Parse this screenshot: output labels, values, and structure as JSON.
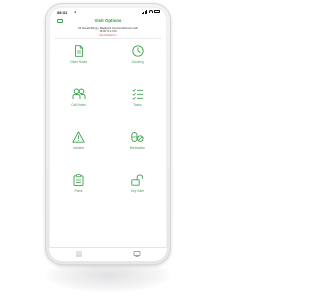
{
  "status_bar": {
    "time": "08:31",
    "nav_indicator": "◂"
  },
  "header": {
    "title": "Visit Options",
    "back_icon": "back-arrow-icon"
  },
  "visit_info": {
    "line1": "Mr Ronald Burgy | Blackpool Council Afternoon Call",
    "line2": "16:00 To 17:00",
    "line3": "Not Clocked In"
  },
  "options": [
    {
      "label": "Client Notes",
      "icon": "document-icon"
    },
    {
      "label": "Clocking",
      "icon": "clock-icon"
    },
    {
      "label": "Call Notes",
      "icon": "people-icon"
    },
    {
      "label": "Tasks",
      "icon": "checklist-icon"
    },
    {
      "label": "Incident",
      "icon": "warning-icon"
    },
    {
      "label": "Medication",
      "icon": "pills-icon"
    },
    {
      "label": "Plans",
      "icon": "clipboard-icon"
    },
    {
      "label": "Key Safe",
      "icon": "unlock-icon"
    }
  ],
  "tab_bar": {
    "tabs": [
      {
        "icon": "list-icon"
      },
      {
        "icon": "monitor-icon"
      }
    ]
  },
  "colors": {
    "accent": "#3aa14a",
    "alert": "#e23b3b"
  }
}
